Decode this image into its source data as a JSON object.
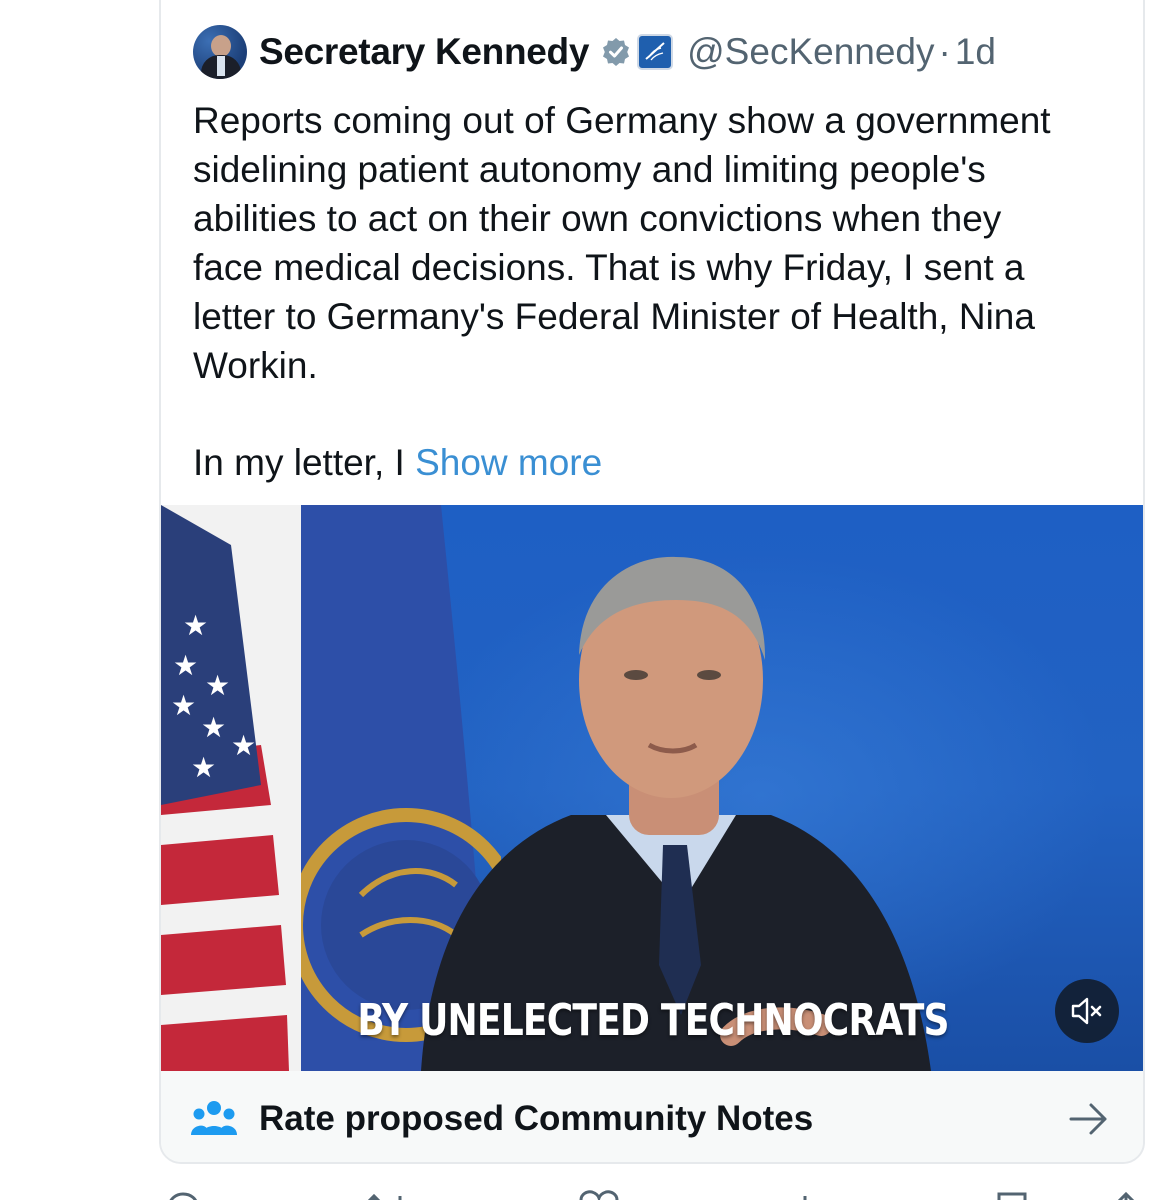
{
  "tweet": {
    "display_name": "Secretary Kennedy",
    "handle": "@SecKennedy",
    "separator": "·",
    "time": "1d",
    "text": "Reports coming out of Germany show a government\nsidelining patient autonomy and limiting people's\nabilities to act on their own convictions when they\nface medical decisions. That is why Friday, I sent a\nletter to Germany's Federal Minister of Health, Nina\nWorkin.",
    "text_continued": "In my letter, I ",
    "show_more": "Show more"
  },
  "media": {
    "caption": "BY UNELECTED TECHNOCRATS",
    "mute_icon": "volume-muted-icon"
  },
  "community_notes": {
    "label": "Rate proposed Community Notes",
    "icon": "people-icon",
    "arrow_icon": "arrow-right-icon"
  },
  "colors": {
    "link": "#3a8fd3",
    "verified": "#829aab",
    "background": "#ffffff",
    "media_blue": "#2262c2"
  }
}
